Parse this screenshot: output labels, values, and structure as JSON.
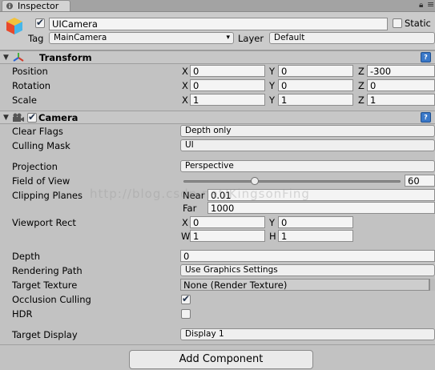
{
  "tab": {
    "label": "Inspector"
  },
  "header": {
    "name_value": "UICamera",
    "static_label": "Static",
    "tag_label": "Tag",
    "tag_value": "MainCamera",
    "layer_label": "Layer",
    "layer_value": "Default"
  },
  "transform": {
    "title": "Transform",
    "position": {
      "label": "Position",
      "x": "0",
      "y": "0",
      "z": "-300"
    },
    "rotation": {
      "label": "Rotation",
      "x": "0",
      "y": "0",
      "z": "0"
    },
    "scale": {
      "label": "Scale",
      "x": "1",
      "y": "1",
      "z": "1"
    },
    "axes": {
      "x": "X",
      "y": "Y",
      "z": "Z"
    }
  },
  "camera": {
    "title": "Camera",
    "clear_flags": {
      "label": "Clear Flags",
      "value": "Depth only"
    },
    "culling_mask": {
      "label": "Culling Mask",
      "value": "UI"
    },
    "projection": {
      "label": "Projection",
      "value": "Perspective"
    },
    "fov": {
      "label": "Field of View",
      "value": "60",
      "slider_fraction": 0.33
    },
    "clipping": {
      "label": "Clipping Planes",
      "near_label": "Near",
      "near": "0.01",
      "far_label": "Far",
      "far": "1000"
    },
    "viewport": {
      "label": "Viewport Rect",
      "x_label": "X",
      "x": "0",
      "y_label": "Y",
      "y": "0",
      "w_label": "W",
      "w": "1",
      "h_label": "H",
      "h": "1"
    },
    "depth": {
      "label": "Depth",
      "value": "0"
    },
    "rendering_path": {
      "label": "Rendering Path",
      "value": "Use Graphics Settings"
    },
    "target_texture": {
      "label": "Target Texture",
      "value": "None (Render Texture)"
    },
    "occlusion_culling": {
      "label": "Occlusion Culling",
      "checked": true
    },
    "hdr": {
      "label": "HDR",
      "checked": false
    },
    "target_display": {
      "label": "Target Display",
      "value": "Display 1"
    }
  },
  "add_component": {
    "label": "Add Component"
  },
  "watermark": "http://blog.csdn.net/KingsonFing"
}
